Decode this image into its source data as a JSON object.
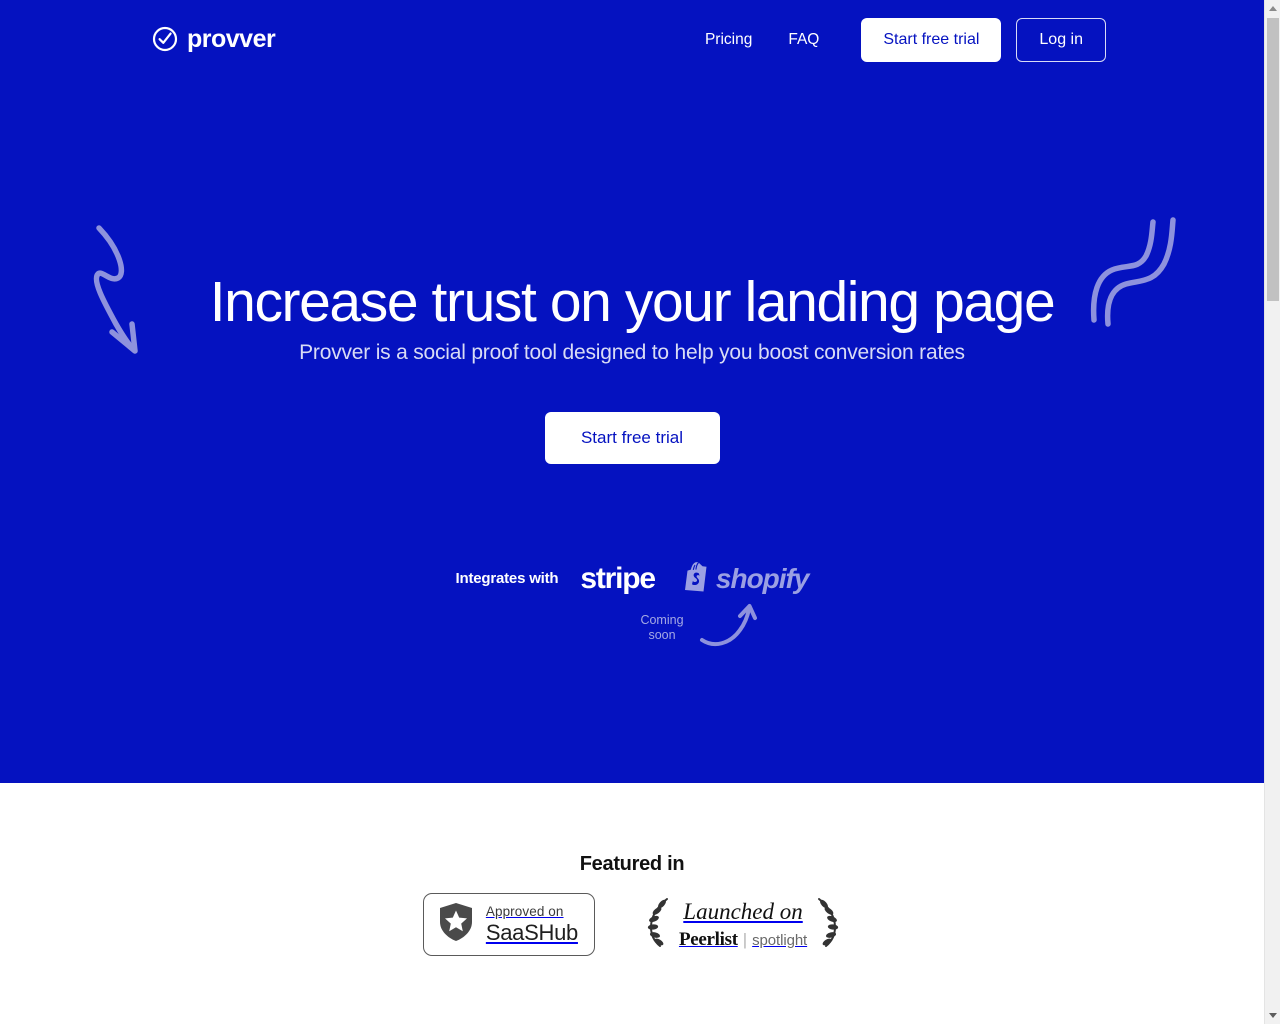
{
  "theme": {
    "brand_blue": "#0512c0",
    "white": "#ffffff",
    "muted_lavender": "#9ba0e3",
    "subhead_color": "#d9dcf5"
  },
  "nav": {
    "brand_name": "provver",
    "brand_icon": "check-circle-icon",
    "links": [
      {
        "label": "Pricing"
      },
      {
        "label": "FAQ"
      }
    ],
    "start_trial_label": "Start free trial",
    "login_label": "Log in"
  },
  "hero": {
    "headline": "Increase trust on your landing page",
    "subheadline": "Provver is a social proof tool designed to help you boost conversion rates",
    "cta_label": "Start free trial",
    "decoration_left": "squiggly-arrow-down-icon",
    "decoration_right": "squiggly-lines-icon"
  },
  "integrations": {
    "label": "Integrates with",
    "logos": [
      {
        "name": "stripe-logo",
        "text": "stripe",
        "status": "available"
      },
      {
        "name": "shopify-logo",
        "text": "shopify",
        "status": "coming-soon"
      }
    ],
    "coming_soon_line1": "Coming",
    "coming_soon_line2": "soon",
    "coming_soon_arrow": "curved-arrow-up-icon"
  },
  "featured": {
    "title": "Featured in",
    "badges": [
      {
        "name": "saashub-badge",
        "icon": "shield-star-icon",
        "top_text": "Approved on",
        "bottom_text": "SaaSHub"
      },
      {
        "name": "peerlist-badge",
        "icon": "laurel-wreath-icon",
        "top_text": "Launched on",
        "brand_text": "Peerlist",
        "divider_text": "|",
        "suffix_text": "spotlight"
      }
    ]
  },
  "scrollbar": {
    "up_arrow": "scroll-up-arrow-icon",
    "down_arrow": "scroll-down-arrow-icon"
  }
}
